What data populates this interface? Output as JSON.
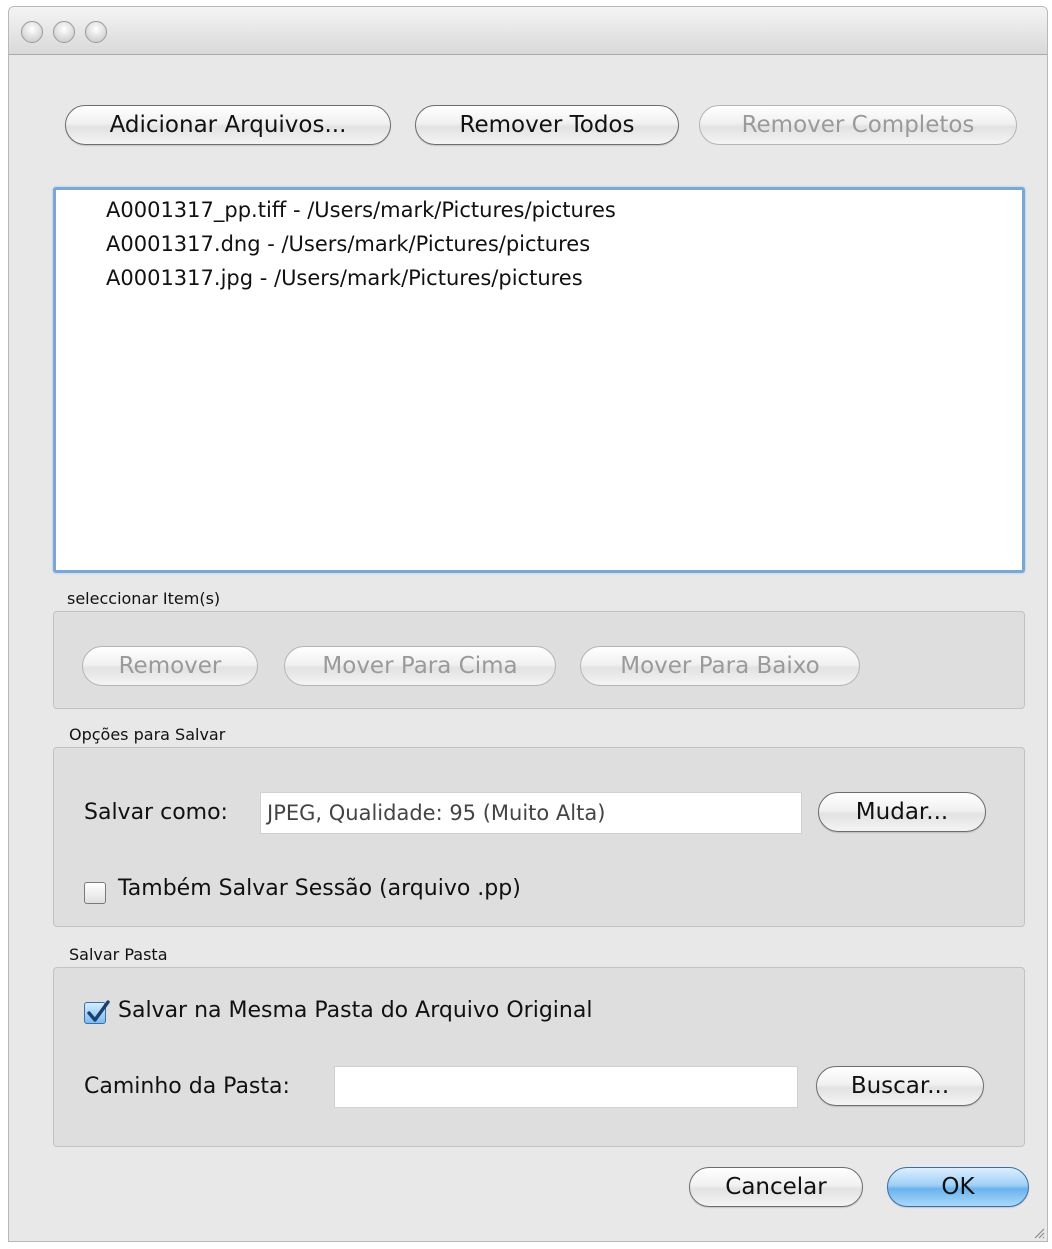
{
  "toolbar": {
    "add_files_label": "Adicionar Arquivos...",
    "remove_all_label": "Remover Todos",
    "remove_completed_label": "Remover Completos"
  },
  "file_list": {
    "items": [
      "A0001317_pp.tiff - /Users/mark/Pictures/pictures",
      "A0001317.dng - /Users/mark/Pictures/pictures",
      "A0001317.jpg - /Users/mark/Pictures/pictures"
    ]
  },
  "select_items": {
    "title": "seleccionar Item(s)",
    "remove_label": "Remover",
    "move_up_label": "Mover Para Cima",
    "move_down_label": "Mover Para Baixo"
  },
  "save_options": {
    "title": "Opções para Salvar",
    "save_as_label": "Salvar como:",
    "save_as_value": "JPEG, Qualidade: 95 (Muito Alta)",
    "change_label": "Mudar...",
    "save_session_label": "Também Salvar Sessão (arquivo .pp)",
    "save_session_checked": false
  },
  "save_folder": {
    "title": "Salvar Pasta",
    "same_folder_label": "Salvar na Mesma Pasta do Arquivo Original",
    "same_folder_checked": true,
    "folder_path_label": "Caminho da Pasta:",
    "folder_path_value": "",
    "browse_label": "Buscar..."
  },
  "footer": {
    "cancel_label": "Cancelar",
    "ok_label": "OK"
  },
  "colors": {
    "focus_ring": "#7aa7d6",
    "default_button": "#6bb3ee",
    "window_bg": "#e8e8e8"
  }
}
